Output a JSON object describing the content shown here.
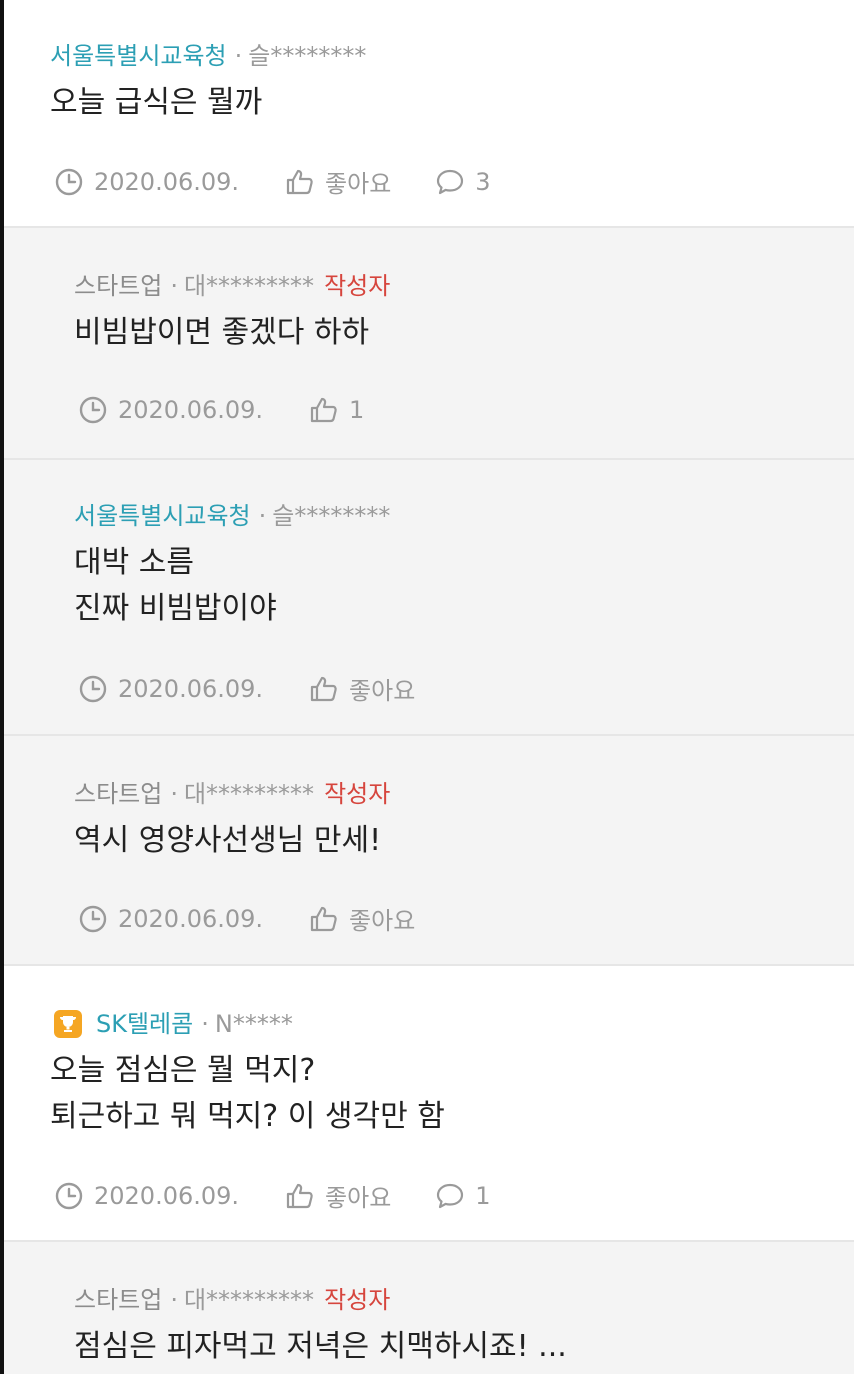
{
  "posts": [
    {
      "company": "서울특별시교육청",
      "separator": "·",
      "user": "슬********",
      "lines": [
        "오늘 급식은 뭘까"
      ],
      "date": "2020.06.09.",
      "like_label": "좋아요",
      "comment_count": "3"
    },
    {
      "company": "스타트업",
      "separator": "·",
      "user": "대*********",
      "author_tag": "작성자",
      "lines": [
        "비빔밥이면 좋겠다 하하"
      ],
      "date": "2020.06.09.",
      "like_label": "1"
    },
    {
      "company": "서울특별시교육청",
      "separator": "·",
      "user": "슬********",
      "lines": [
        "대박 소름",
        "진짜 비빔밥이야"
      ],
      "date": "2020.06.09.",
      "like_label": "좋아요"
    },
    {
      "company": "스타트업",
      "separator": "·",
      "user": "대*********",
      "author_tag": "작성자",
      "lines": [
        "역시 영양사선생님 만세!"
      ],
      "date": "2020.06.09.",
      "like_label": "좋아요"
    },
    {
      "company": "SK텔레콤",
      "separator": "·",
      "user": "N*****",
      "lines": [
        "오늘 점심은 뭘 먹지?",
        "퇴근하고 뭐 먹지? 이 생각만 함"
      ],
      "date": "2020.06.09.",
      "like_label": "좋아요",
      "comment_count": "1"
    },
    {
      "company": "스타트업",
      "separator": "·",
      "user": "대*********",
      "author_tag": "작성자",
      "lines": [
        "점심은 피자먹고 저녁은 치맥하시죠! ..."
      ]
    }
  ],
  "colors": {
    "company_accent": "#2c9fb4",
    "author_tag": "#d6453d",
    "meta_gray": "#9a9a9a",
    "reply_background": "#f4f4f4",
    "trophy_badge": "#f5a623"
  },
  "icons": {
    "date": "clock-icon",
    "like": "thumbs-up-icon",
    "comment": "speech-bubble-icon",
    "badge": "trophy-icon"
  }
}
